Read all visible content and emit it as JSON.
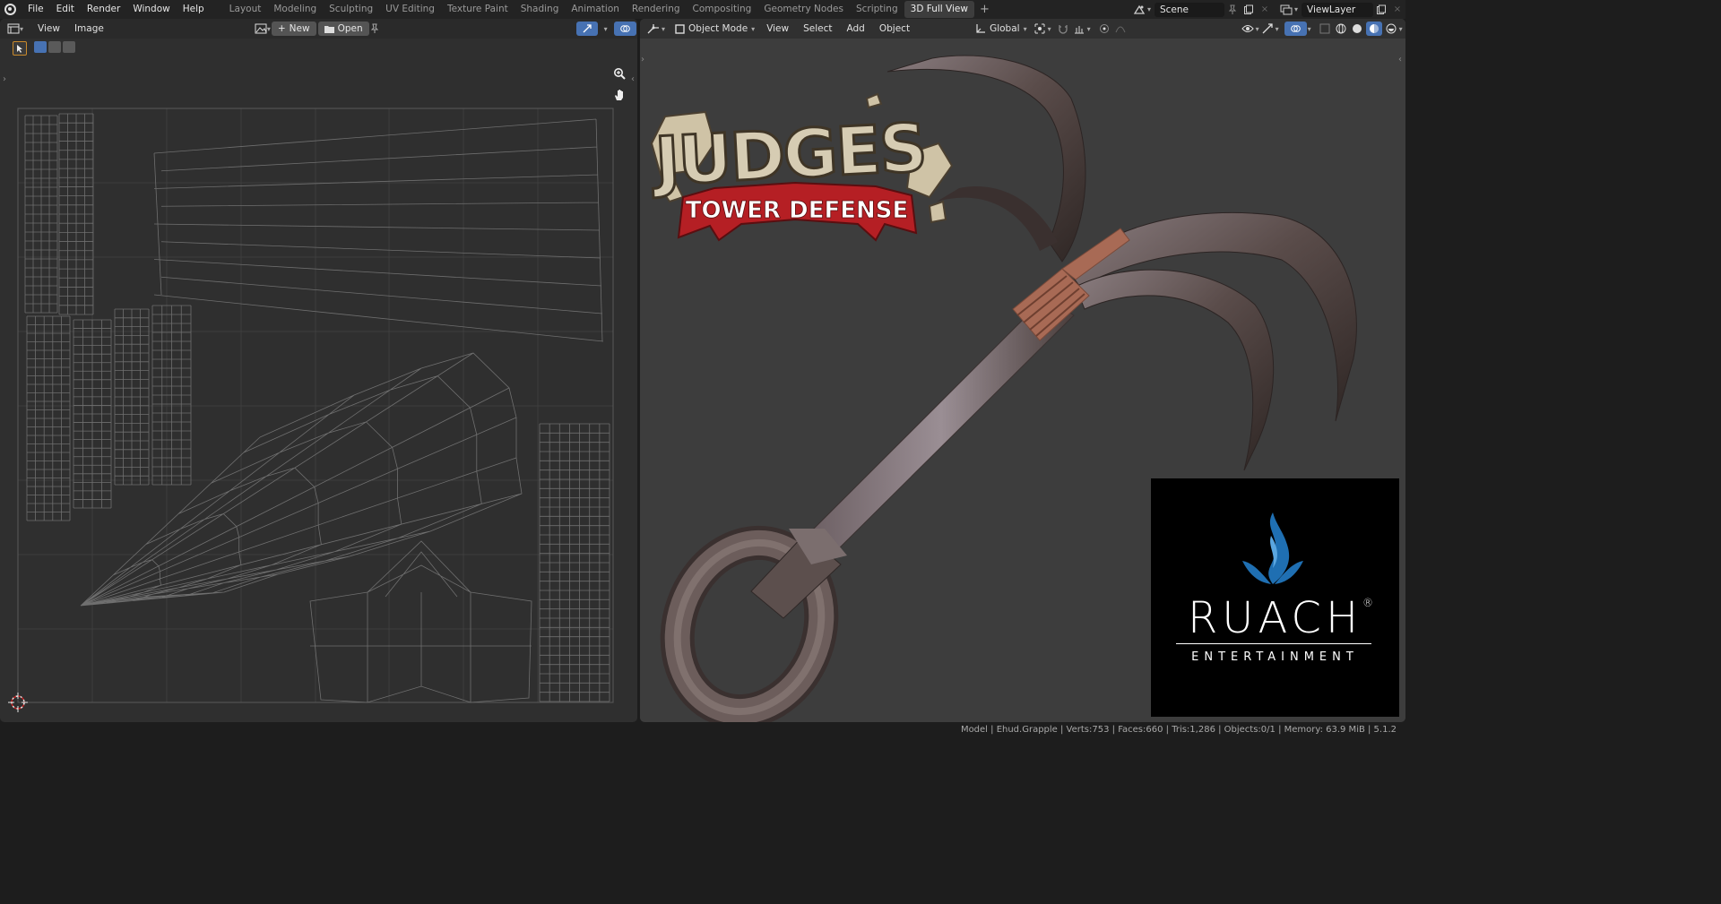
{
  "topbar": {
    "menus": [
      "File",
      "Edit",
      "Render",
      "Window",
      "Help"
    ],
    "workspaces": [
      "Layout",
      "Modeling",
      "Sculpting",
      "UV Editing",
      "Texture Paint",
      "Shading",
      "Animation",
      "Rendering",
      "Compositing",
      "Geometry Nodes",
      "Scripting",
      "3D Full View"
    ],
    "active_workspace": "3D Full View",
    "add_workspace": "+",
    "scene": "Scene",
    "view_layer": "ViewLayer"
  },
  "uv_editor": {
    "menus": [
      "View",
      "Image"
    ],
    "new_label": "New",
    "open_label": "Open"
  },
  "viewport": {
    "mode": "Object Mode",
    "menus": [
      "View",
      "Select",
      "Add",
      "Object"
    ],
    "orientation": "Global"
  },
  "overlays": {
    "game_logo_title": "JUDGES",
    "game_logo_banner": "TOWER DEFENSE",
    "company_name": "RUACH",
    "company_mark": "®",
    "company_tagline": "ENTERTAINMENT"
  },
  "statusbar": {
    "text": "Model | Ehud.Grapple | Verts:753 | Faces:660 | Tris:1,286 | Objects:0/1 | Memory: 63.9 MiB | 5.1.2"
  },
  "colors": {
    "accent_blue": "#4772b3",
    "active_tool_orange": "#c98a2b",
    "banner_red": "#b51f24",
    "flame_blue": "#1f6fb2"
  }
}
